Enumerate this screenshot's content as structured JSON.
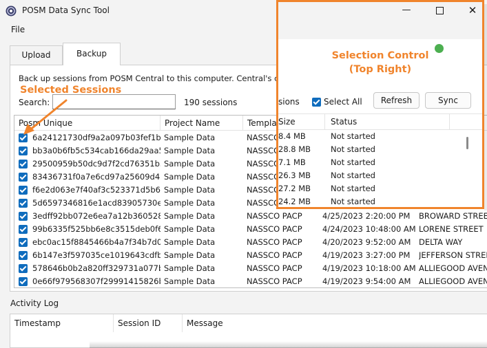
{
  "app": {
    "title": "POSM Data Sync Tool"
  },
  "menu": {
    "file": "File"
  },
  "tabs": [
    {
      "label": "Upload"
    },
    {
      "label": "Backup"
    }
  ],
  "backup": {
    "description": "Back up sessions from POSM Central to this computer. Central's copy r",
    "search_label": "Search:",
    "search_value": "",
    "session_count": "190 sessions"
  },
  "table": {
    "columns": [
      "Posm Unique",
      "Project Name",
      "Templat"
    ],
    "rows": [
      {
        "id": "6a24121730df9a2a097b03fef1b69...",
        "project": "Sample Data",
        "template": "NASSCO",
        "date": "",
        "street": ""
      },
      {
        "id": "bb3a0b6fb5c534cab166da29aa54...",
        "project": "Sample Data",
        "template": "NASSCO",
        "date": "",
        "street": ""
      },
      {
        "id": "29500959b50dc9d7f2cd76351b5a...",
        "project": "Sample Data",
        "template": "NASSCO",
        "date": "",
        "street": ""
      },
      {
        "id": "83436731f0a7e6cd97a25609d48ec...",
        "project": "Sample Data",
        "template": "NASSCO",
        "date": "",
        "street": ""
      },
      {
        "id": "f6e2d063e7f40af3c523371d5b630...",
        "project": "Sample Data",
        "template": "NASSCO",
        "date": "",
        "street": ""
      },
      {
        "id": "5d6597346816e1acd83905730ed2...",
        "project": "Sample Data",
        "template": "NASSCO",
        "date": "",
        "street": ""
      },
      {
        "id": "3edff92bb072e6ea7a12b360528a9...",
        "project": "Sample Data",
        "template": "NASSCO PACP",
        "date": "4/25/2023 2:20:00 PM",
        "street": "BROWARD STREET"
      },
      {
        "id": "99b6335f525bb6e8c3515deb0f64...",
        "project": "Sample Data",
        "template": "NASSCO PACP",
        "date": "4/24/2023 10:48:00 AM",
        "street": "LORENE STREET"
      },
      {
        "id": "ebc0ac15f8845466b4a7f34b7d041...",
        "project": "Sample Data",
        "template": "NASSCO PACP",
        "date": "4/20/2023 9:52:00 AM",
        "street": "DELTA WAY"
      },
      {
        "id": "6b147e3f597035ce1019643cdfb5f...",
        "project": "Sample Data",
        "template": "NASSCO PACP",
        "date": "4/19/2023 3:27:00 PM",
        "street": "JEFFERSON STREET"
      },
      {
        "id": "578646b0b2a820ff329731a077b45...",
        "project": "Sample Data",
        "template": "NASSCO PACP",
        "date": "4/19/2023 10:18:00 AM",
        "street": "ALLIEGOOD AVENUE"
      },
      {
        "id": "0e66f979568307f29991415826b8c...",
        "project": "Sample Data",
        "template": "NASSCO PACP",
        "date": "4/19/2023 9:54:00 AM",
        "street": "ALLIEGOOD AVENUE"
      }
    ]
  },
  "activity": {
    "label": "Activity Log",
    "columns": [
      "Timestamp",
      "Session ID",
      "Message"
    ]
  },
  "callout": {
    "title_line1": "Selection Control",
    "title_line2": "(Top Right)",
    "sessions_fragment": "sions",
    "select_all": "Select All",
    "refresh": "Refresh",
    "sync": "Sync",
    "col_size": "Size",
    "col_status": "Status",
    "rows": [
      {
        "size": "8.4 MB",
        "status": "Not started"
      },
      {
        "size": "28.8 MB",
        "status": "Not started"
      },
      {
        "size": "7.1 MB",
        "status": "Not started"
      },
      {
        "size": "26.3 MB",
        "status": "Not started"
      },
      {
        "size": "27.2 MB",
        "status": "Not started"
      },
      {
        "size": "24.2 MB",
        "status": "Not started"
      }
    ]
  },
  "annotation": {
    "selected_sessions": "Selected Sessions"
  },
  "colors": {
    "accent_orange": "#f0842c",
    "checkbox_blue": "#0f6cbd",
    "status_green": "#4caf50"
  }
}
